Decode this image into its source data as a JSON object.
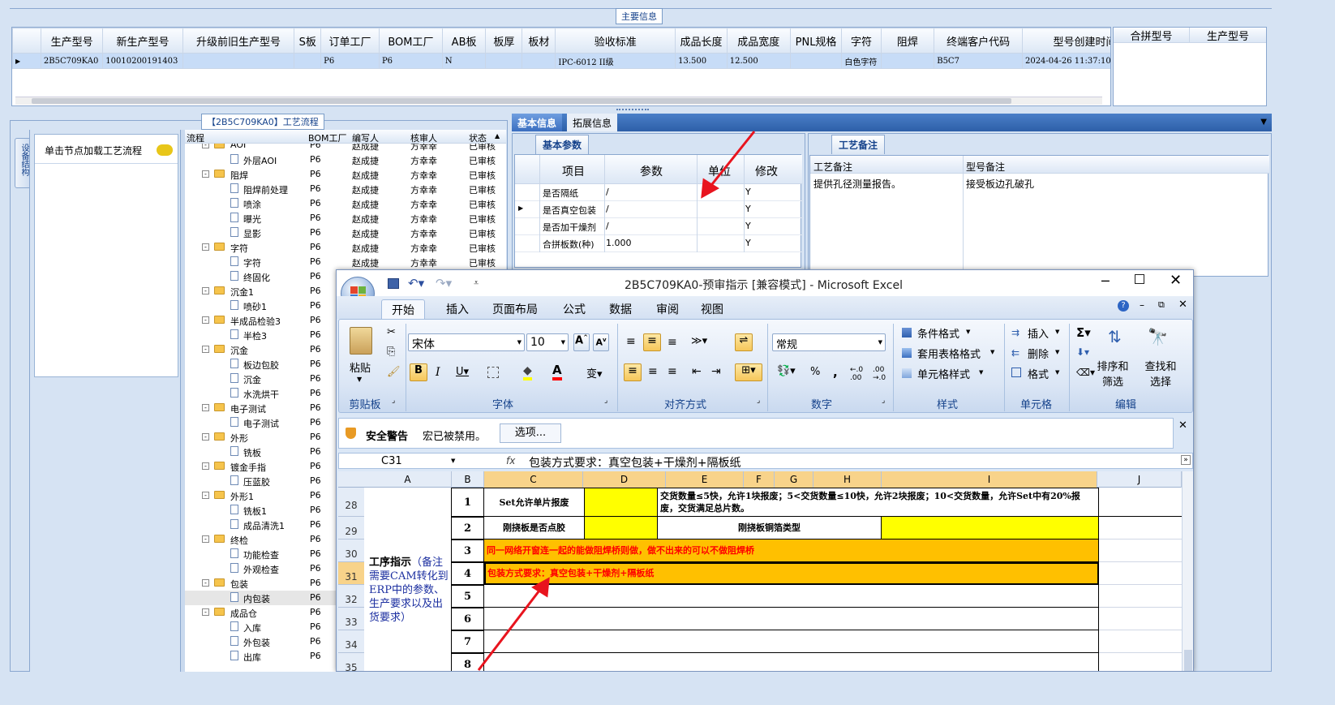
{
  "top": {
    "legend": "主要信息",
    "columns": [
      "生产型号",
      "新生产型号",
      "升级前旧生产型号",
      "S板",
      "订单工厂",
      "BOM工厂",
      "AB板",
      "板厚",
      "板材",
      "验收标准",
      "成品长度",
      "成品宽度",
      "PNL规格",
      "字符",
      "阻焊",
      "终端客户代码",
      "型号创建时间"
    ],
    "row": [
      "2B5C709KA0",
      "10010200191403",
      "",
      "",
      "P6",
      "P6",
      "N",
      "",
      "",
      "IPC-6012 II级",
      "13.500",
      "12.500",
      "",
      "白色字符",
      "",
      "B5C7",
      "2024-04-26 11:37:10"
    ],
    "right_columns": [
      "合拼型号",
      "生产型号"
    ]
  },
  "process": {
    "legend": "【2B5C709KA0】工艺流程",
    "left_tab": "设备结构",
    "load_label": "单击节点加载工艺流程",
    "columns": [
      "流程",
      "BOM工厂",
      "编写人",
      "核审人",
      "状态"
    ],
    "rows": [
      {
        "name": "AOI",
        "lvl": 0,
        "type": "folder",
        "bom": "P6",
        "w": "赵成捷",
        "r": "方幸幸",
        "s": "已审核"
      },
      {
        "name": "外层AOI",
        "lvl": 1,
        "type": "doc",
        "bom": "P6",
        "w": "赵成捷",
        "r": "方幸幸",
        "s": "已审核"
      },
      {
        "name": "阻焊",
        "lvl": 0,
        "type": "folder",
        "bom": "P6",
        "w": "赵成捷",
        "r": "方幸幸",
        "s": "已审核"
      },
      {
        "name": "阻焊前处理",
        "lvl": 1,
        "type": "doc",
        "bom": "P6",
        "w": "赵成捷",
        "r": "方幸幸",
        "s": "已审核"
      },
      {
        "name": "喷涂",
        "lvl": 1,
        "type": "doc",
        "bom": "P6",
        "w": "赵成捷",
        "r": "方幸幸",
        "s": "已审核"
      },
      {
        "name": "曝光",
        "lvl": 1,
        "type": "doc",
        "bom": "P6",
        "w": "赵成捷",
        "r": "方幸幸",
        "s": "已审核"
      },
      {
        "name": "显影",
        "lvl": 1,
        "type": "doc",
        "bom": "P6",
        "w": "赵成捷",
        "r": "方幸幸",
        "s": "已审核"
      },
      {
        "name": "字符",
        "lvl": 0,
        "type": "folder",
        "bom": "P6",
        "w": "赵成捷",
        "r": "方幸幸",
        "s": "已审核"
      },
      {
        "name": "字符",
        "lvl": 1,
        "type": "doc",
        "bom": "P6",
        "w": "赵成捷",
        "r": "方幸幸",
        "s": "已审核"
      },
      {
        "name": "终固化",
        "lvl": 1,
        "type": "doc",
        "bom": "P6",
        "w": "",
        "r": "",
        "s": ""
      },
      {
        "name": "沉金1",
        "lvl": 0,
        "type": "folder",
        "bom": "P6",
        "w": "",
        "r": "",
        "s": ""
      },
      {
        "name": "喷砂1",
        "lvl": 1,
        "type": "doc",
        "bom": "P6",
        "w": "",
        "r": "",
        "s": ""
      },
      {
        "name": "半成品检验3",
        "lvl": 0,
        "type": "folder",
        "bom": "P6",
        "w": "",
        "r": "",
        "s": ""
      },
      {
        "name": "半检3",
        "lvl": 1,
        "type": "doc",
        "bom": "P6",
        "w": "",
        "r": "",
        "s": ""
      },
      {
        "name": "沉金",
        "lvl": 0,
        "type": "folder",
        "bom": "P6",
        "w": "",
        "r": "",
        "s": ""
      },
      {
        "name": "板边包胶",
        "lvl": 1,
        "type": "doc",
        "bom": "P6",
        "w": "",
        "r": "",
        "s": ""
      },
      {
        "name": "沉金",
        "lvl": 1,
        "type": "doc",
        "bom": "P6",
        "w": "",
        "r": "",
        "s": ""
      },
      {
        "name": "水洗烘干",
        "lvl": 1,
        "type": "doc",
        "bom": "P6",
        "w": "",
        "r": "",
        "s": ""
      },
      {
        "name": "电子测试",
        "lvl": 0,
        "type": "folder",
        "bom": "P6",
        "w": "",
        "r": "",
        "s": ""
      },
      {
        "name": "电子测试",
        "lvl": 1,
        "type": "doc",
        "bom": "P6",
        "w": "",
        "r": "",
        "s": ""
      },
      {
        "name": "外形",
        "lvl": 0,
        "type": "folder",
        "bom": "P6",
        "w": "",
        "r": "",
        "s": ""
      },
      {
        "name": "铣板",
        "lvl": 1,
        "type": "doc",
        "bom": "P6",
        "w": "",
        "r": "",
        "s": ""
      },
      {
        "name": "镀金手指",
        "lvl": 0,
        "type": "folder",
        "bom": "P6",
        "w": "",
        "r": "",
        "s": ""
      },
      {
        "name": "压蓝胶",
        "lvl": 1,
        "type": "doc",
        "bom": "P6",
        "w": "",
        "r": "",
        "s": ""
      },
      {
        "name": "外形1",
        "lvl": 0,
        "type": "folder",
        "bom": "P6",
        "w": "",
        "r": "",
        "s": ""
      },
      {
        "name": "铣板1",
        "lvl": 1,
        "type": "doc",
        "bom": "P6",
        "w": "",
        "r": "",
        "s": ""
      },
      {
        "name": "成品清洗1",
        "lvl": 1,
        "type": "doc",
        "bom": "P6",
        "w": "",
        "r": "",
        "s": ""
      },
      {
        "name": "终检",
        "lvl": 0,
        "type": "folder",
        "bom": "P6",
        "w": "",
        "r": "",
        "s": ""
      },
      {
        "name": "功能检查",
        "lvl": 1,
        "type": "doc",
        "bom": "P6",
        "w": "",
        "r": "",
        "s": ""
      },
      {
        "name": "外观检查",
        "lvl": 1,
        "type": "doc",
        "bom": "P6",
        "w": "",
        "r": "",
        "s": ""
      },
      {
        "name": "包装",
        "lvl": 0,
        "type": "folder",
        "bom": "P6",
        "w": "",
        "r": "",
        "s": ""
      },
      {
        "name": "内包装",
        "lvl": 1,
        "type": "doc",
        "bom": "P6",
        "w": "",
        "r": "",
        "s": "",
        "sel": true
      },
      {
        "name": "成品仓",
        "lvl": 0,
        "type": "folder",
        "bom": "P6",
        "w": "",
        "r": "",
        "s": ""
      },
      {
        "name": "入库",
        "lvl": 1,
        "type": "doc",
        "bom": "P6",
        "w": "",
        "r": "",
        "s": ""
      },
      {
        "name": "外包装",
        "lvl": 1,
        "type": "doc",
        "bom": "P6",
        "w": "",
        "r": "",
        "s": ""
      },
      {
        "name": "出库",
        "lvl": 1,
        "type": "doc",
        "bom": "P6",
        "w": "",
        "r": "",
        "s": ""
      }
    ]
  },
  "info": {
    "tabs": [
      "基本信息",
      "拓展信息"
    ],
    "sub_tab": "基本参数",
    "columns": [
      "项目",
      "参数",
      "单位",
      "修改"
    ],
    "rows": [
      {
        "item": "是否隔纸",
        "param": "/",
        "unit": "",
        "mod": "Y"
      },
      {
        "item": "是否真空包装",
        "param": "/",
        "unit": "",
        "mod": "Y"
      },
      {
        "item": "是否加干燥剂",
        "param": "/",
        "unit": "",
        "mod": "Y"
      },
      {
        "item": "合拼板数(种)",
        "param": "1.000",
        "unit": "",
        "mod": "Y"
      }
    ],
    "remark_tab": "工艺备注",
    "remark_columns": [
      "工艺备注",
      "型号备注"
    ],
    "remark_text": "提供孔径测量报告。",
    "model_remark": "接受板边孔破孔"
  },
  "excel": {
    "title": "2B5C709KA0-预审指示  [兼容模式] - Microsoft Excel",
    "tabs": [
      "开始",
      "插入",
      "页面布局",
      "公式",
      "数据",
      "审阅",
      "视图"
    ],
    "clipboard": {
      "paste": "粘贴",
      "group": "剪贴板"
    },
    "font": {
      "name": "宋体",
      "size": "10",
      "group": "字体"
    },
    "align_group": "对齐方式",
    "number": {
      "format": "常规",
      "group": "数字"
    },
    "styles": {
      "cond": "条件格式",
      "table": "套用表格格式",
      "cell": "单元格样式",
      "group": "样式"
    },
    "cells": {
      "insert": "插入",
      "delete": "删除",
      "format": "格式",
      "group": "单元格"
    },
    "edit": {
      "sort": "排序和筛选",
      "find": "查找和选择",
      "group": "编辑"
    },
    "security": {
      "title": "安全警告",
      "msg": "宏已被禁用。",
      "btn": "选项..."
    },
    "namebox": "C31",
    "fx": "fx",
    "formula": "包装方式要求：真空包装+干燥剂+隔板纸",
    "col_headers": [
      "A",
      "B",
      "C",
      "D",
      "E",
      "F",
      "G",
      "H",
      "I",
      "J"
    ],
    "row_headers": [
      "28",
      "29",
      "30",
      "31",
      "32",
      "33",
      "34",
      "35"
    ],
    "a_label": "工序指示",
    "a_note": "（备注需要CAM转化到ERP中的参数、生产要求以及出货要求）",
    "b_nums": [
      "1",
      "2",
      "3",
      "4",
      "5",
      "6",
      "7",
      "8"
    ],
    "r1_c": "Set允许单片报废",
    "r1_text": "交货数量≤5快，允许1块报废；5<交货数量≤10快，允许2块报废；10<交货数量，允许Set中有20%报废，交货满足总片数。",
    "r2_c": "刚挠板是否点胶",
    "r2_mid": "刚挠板铜箔类型",
    "r3_text": "同一网络开窗连一起的能做阻焊桥则做，做不出来的可以不做阻焊桥",
    "r4_text": "包装方式要求：真空包装+干燥剂+隔板纸"
  },
  "colors": {
    "accent": "#15428b",
    "selected": "#c7dcf7",
    "yellow": "#ffff00",
    "orange": "#ffc000",
    "red_text": "#ff0000",
    "arrow": "#e8141e"
  }
}
